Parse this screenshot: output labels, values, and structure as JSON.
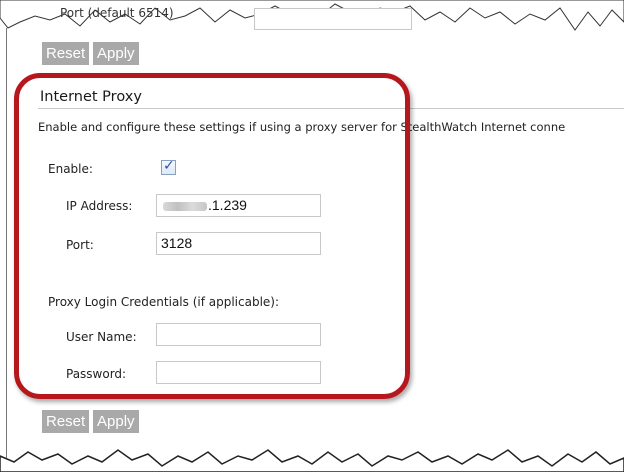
{
  "top": {
    "field_label": "Port (default 6514)",
    "reset_label": "Reset",
    "apply_label": "Apply"
  },
  "section": {
    "title": "Internet Proxy",
    "description": "Enable and configure these settings if using a proxy server for StealthWatch Internet conne",
    "enable_label": "Enable:",
    "enable_checked": true,
    "ip_label": "IP Address:",
    "ip_value_suffix": ".1.239",
    "port_label": "Port:",
    "port_value": "3128",
    "credentials_label": "Proxy Login Credentials (if applicable):",
    "username_label": "User Name:",
    "username_value": "",
    "password_label": "Password:",
    "password_value": ""
  },
  "bottom": {
    "reset_label": "Reset",
    "apply_label": "Apply"
  },
  "colors": {
    "button_bg": "#a9a9a9",
    "highlight": "#b5171d",
    "checkbox_check": "#2a55a5"
  },
  "icons": {
    "checkbox": "check-icon"
  }
}
